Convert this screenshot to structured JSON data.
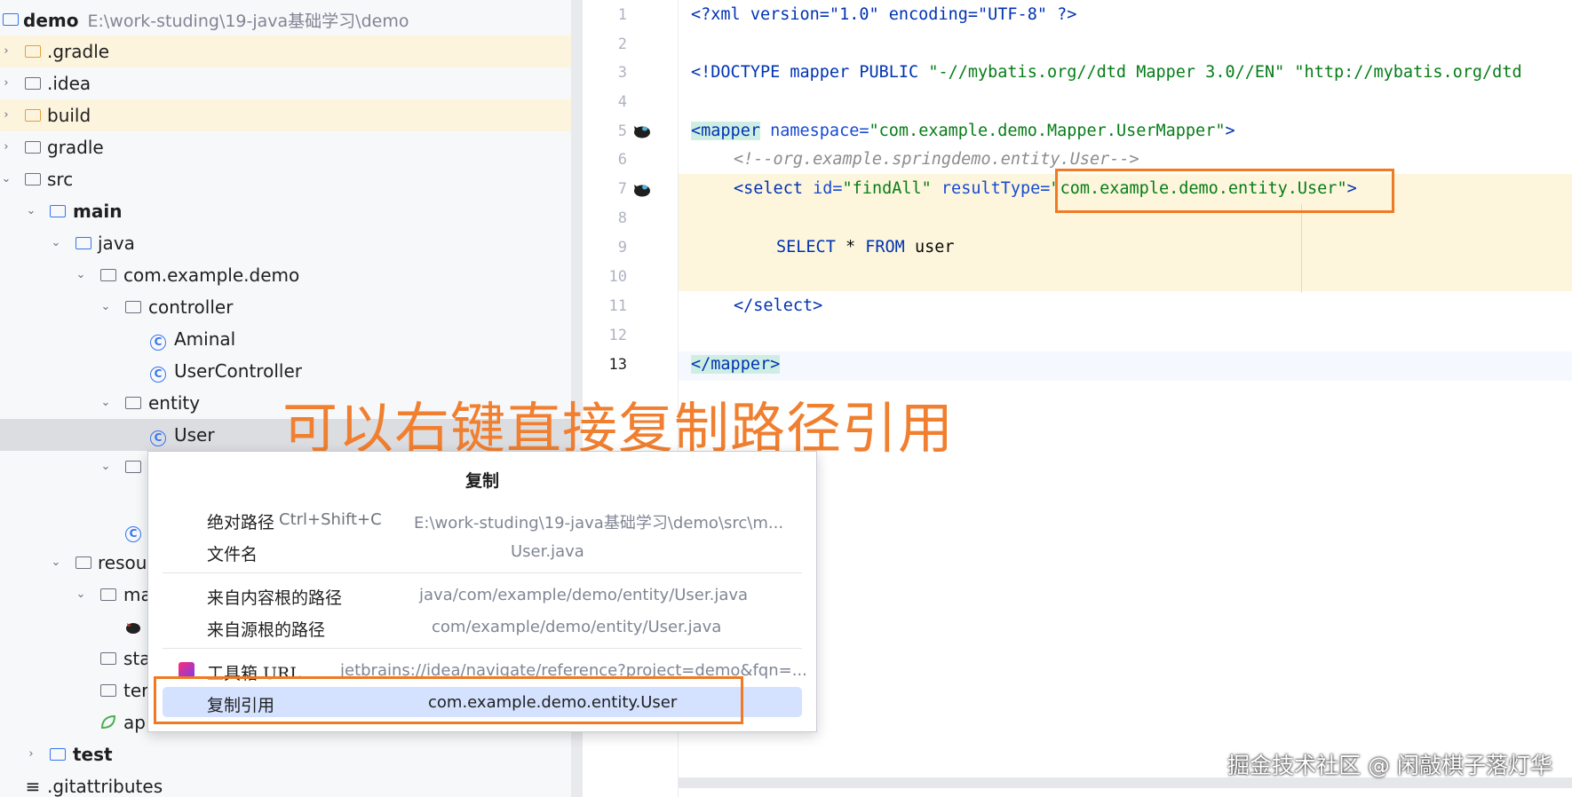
{
  "project_tree": {
    "root": {
      "name": "demo",
      "path": "E:\\work-studing\\19-java基础学习\\demo"
    },
    "items": [
      {
        "label": ".gradle"
      },
      {
        "label": ".idea"
      },
      {
        "label": "build"
      },
      {
        "label": "gradle"
      },
      {
        "label": "src"
      },
      {
        "label": "main"
      },
      {
        "label": "java"
      },
      {
        "label": "com.example.demo"
      },
      {
        "label": "controller"
      },
      {
        "label": "Aminal"
      },
      {
        "label": "UserController"
      },
      {
        "label": "entity"
      },
      {
        "label": "User"
      },
      {
        "label": "resour"
      },
      {
        "label": "ma"
      },
      {
        "label": "sta"
      },
      {
        "label": "ter"
      },
      {
        "label": "ap"
      },
      {
        "label": "test"
      },
      {
        "label": ".gitattributes"
      }
    ]
  },
  "editor": {
    "line_numbers": [
      "1",
      "2",
      "3",
      "4",
      "5",
      "6",
      "7",
      "8",
      "9",
      "10",
      "11",
      "12",
      "13"
    ],
    "lines": {
      "l1": "<?xml version=\"1.0\" encoding=\"UTF-8\" ?>",
      "l3a": "<!DOCTYPE mapper PUBLIC ",
      "l3b": "\"-//mybatis.org//dtd Mapper 3.0//EN\" \"http://mybatis.org/dtd",
      "l5_tag": "<mapper",
      "l5_attr": " namespace=",
      "l5_val": "\"com.example.demo.Mapper.UserMapper\"",
      "l5_end": ">",
      "l6": "<!--org.example.springdemo.entity.User-->",
      "l7_tag": "<select",
      "l7_attr1": " id=",
      "l7_val1": "\"findAll\"",
      "l7_attr2": " resultType=",
      "l7_val2": "\"com.example.demo.entity.User\"",
      "l7_end": ">",
      "l9_kw1": "SELECT",
      "l9_mid": " * ",
      "l9_kw2": "FROM",
      "l9_tbl": " user",
      "l11": "</select>",
      "l13_tag": "</mapper",
      "l13_end": ">"
    }
  },
  "caption": "可以右键直接复制路径引用",
  "context_menu": {
    "title": "复制",
    "items": [
      {
        "label": "绝对路径",
        "shortcut": "Ctrl+Shift+C",
        "value": "E:\\work-studing\\19-java基础学习\\demo\\src\\m..."
      },
      {
        "label": "文件名",
        "value": "User.java"
      },
      {
        "label": "来自内容根的路径",
        "value": "java/com/example/demo/entity/User.java"
      },
      {
        "label": "来自源根的路径",
        "value": "com/example/demo/entity/User.java"
      },
      {
        "label": "工具箱 URL",
        "value": "jetbrains://idea/navigate/reference?project=demo&fqn=..."
      },
      {
        "label": "复制引用",
        "value": "com.example.demo.entity.User"
      }
    ]
  },
  "watermark": "掘金技术社区 @ 闲敲棋子落灯华",
  "colors": {
    "accent_orange": "#f07a24",
    "selection_blue": "#d4e2ff"
  }
}
